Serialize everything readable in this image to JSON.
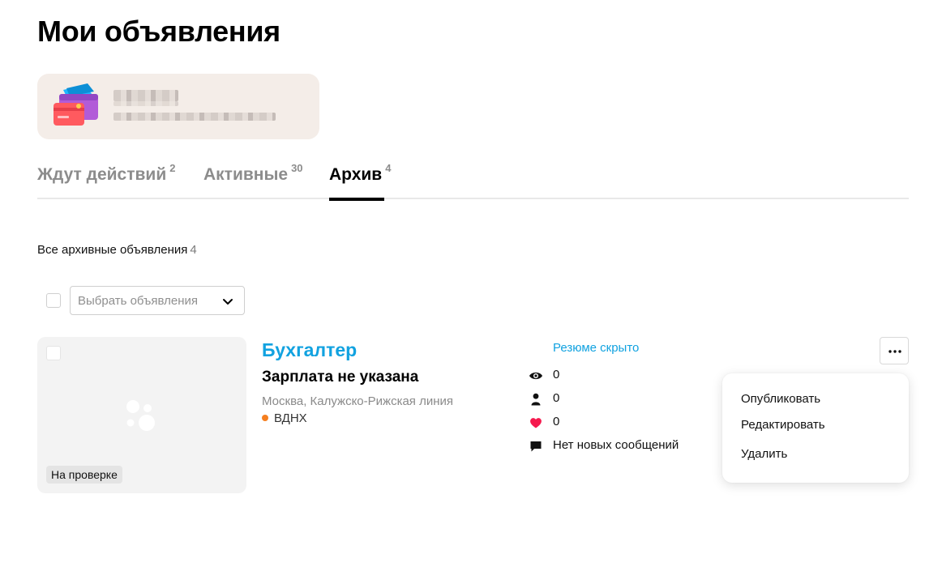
{
  "page": {
    "title": "Мои объявления"
  },
  "tabs": [
    {
      "label": "Ждут действий",
      "count": "2",
      "active": false
    },
    {
      "label": "Активные",
      "count": "30",
      "active": false
    },
    {
      "label": "Архив",
      "count": "4",
      "active": true
    }
  ],
  "section": {
    "label": "Все архивные объявления",
    "count": "4"
  },
  "bulk": {
    "select_placeholder": "Выбрать объявления"
  },
  "ad": {
    "title": "Бухгалтер",
    "salary": "Зарплата не указана",
    "location": "Москва, Калужско-Рижская линия",
    "metro": "ВДНХ",
    "metro_color": "#f57f20",
    "status": "На проверке",
    "resume_status": "Резюме скрыто",
    "stats": {
      "views": "0",
      "contacts": "0",
      "favorites": "0",
      "messages": "Нет новых сообщений"
    }
  },
  "menu": {
    "items": [
      "Опубликовать",
      "Редактировать",
      "Удалить"
    ]
  },
  "colors": {
    "accent": "#11a2e0",
    "favorite": "#f5194d",
    "wallet_card_bg": "#f4ede8"
  }
}
